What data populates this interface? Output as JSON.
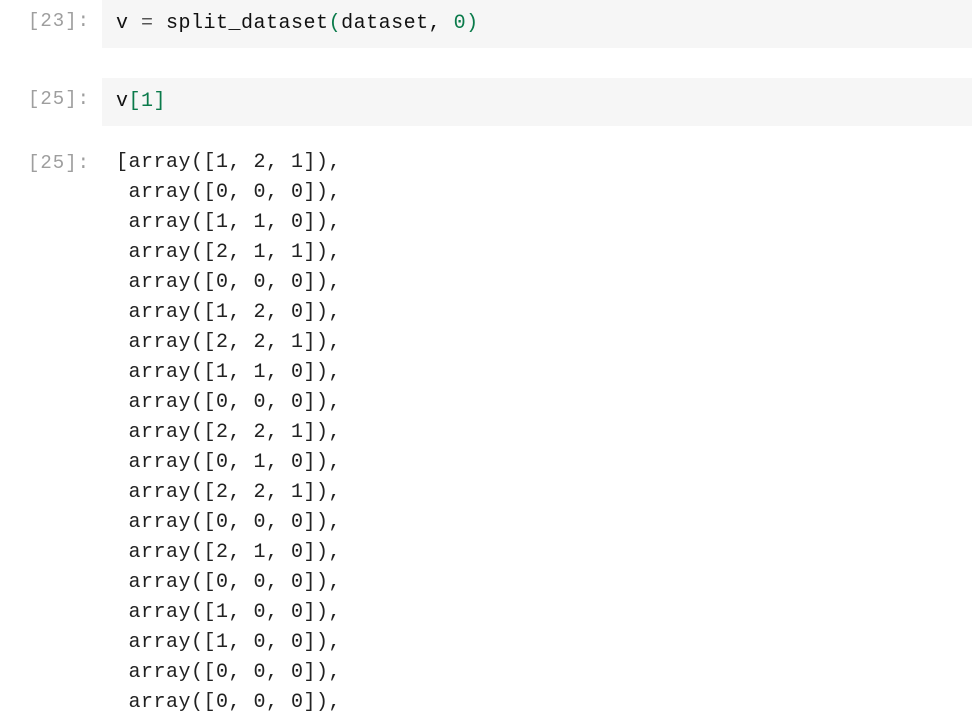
{
  "cells": [
    {
      "prompt": "[23]:",
      "type": "input",
      "code_parts": [
        {
          "t": "v ",
          "c": "tk-var"
        },
        {
          "t": "=",
          "c": "tk-op"
        },
        {
          "t": " split_dataset",
          "c": "tk-func"
        },
        {
          "t": "(",
          "c": "tk-paren"
        },
        {
          "t": "dataset",
          "c": "tk-var"
        },
        {
          "t": ",",
          "c": "tk-comma"
        },
        {
          "t": " ",
          "c": "tk-var"
        },
        {
          "t": "0",
          "c": "tk-num"
        },
        {
          "t": ")",
          "c": "tk-paren"
        }
      ]
    },
    {
      "prompt": "[25]:",
      "type": "input",
      "code_parts": [
        {
          "t": "v",
          "c": "tk-var"
        },
        {
          "t": "[",
          "c": "tk-bracket"
        },
        {
          "t": "1",
          "c": "tk-num"
        },
        {
          "t": "]",
          "c": "tk-bracket"
        }
      ]
    },
    {
      "prompt": "[25]:",
      "type": "output",
      "lines": [
        "[array([1, 2, 1]),",
        " array([0, 0, 0]),",
        " array([1, 1, 0]),",
        " array([2, 1, 1]),",
        " array([0, 0, 0]),",
        " array([1, 2, 0]),",
        " array([2, 2, 1]),",
        " array([1, 1, 0]),",
        " array([0, 0, 0]),",
        " array([2, 2, 1]),",
        " array([0, 1, 0]),",
        " array([2, 2, 1]),",
        " array([0, 0, 0]),",
        " array([2, 1, 0]),",
        " array([0, 0, 0]),",
        " array([1, 0, 0]),",
        " array([1, 0, 0]),",
        " array([0, 0, 0]),",
        " array([0, 0, 0]),"
      ]
    }
  ]
}
